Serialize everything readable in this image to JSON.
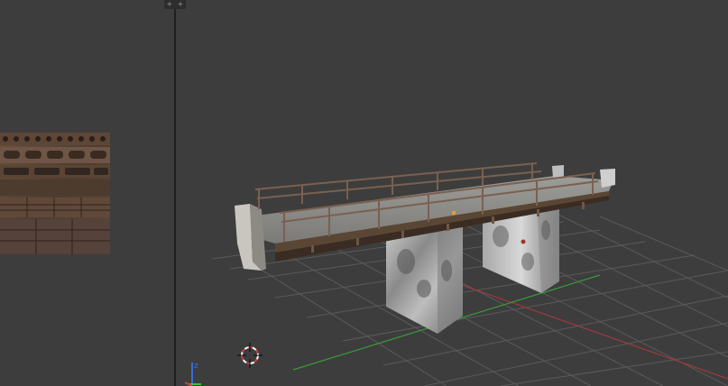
{
  "app": {
    "accent": "#d83b3b"
  },
  "left_panel": {
    "texture_name": "",
    "handle_icons": [
      "split-left-icon",
      "split-right-icon"
    ],
    "handle_glyphs": [
      "+",
      "+"
    ]
  },
  "viewport": {
    "axis_gizmo": {
      "z_label": "z",
      "x_color": "#d83b3b",
      "y_color": "#3bbf3b",
      "z_color": "#3b6bd8"
    },
    "cursor_icon": "3d-cursor-icon",
    "grid_color": "#5a5a5a"
  }
}
